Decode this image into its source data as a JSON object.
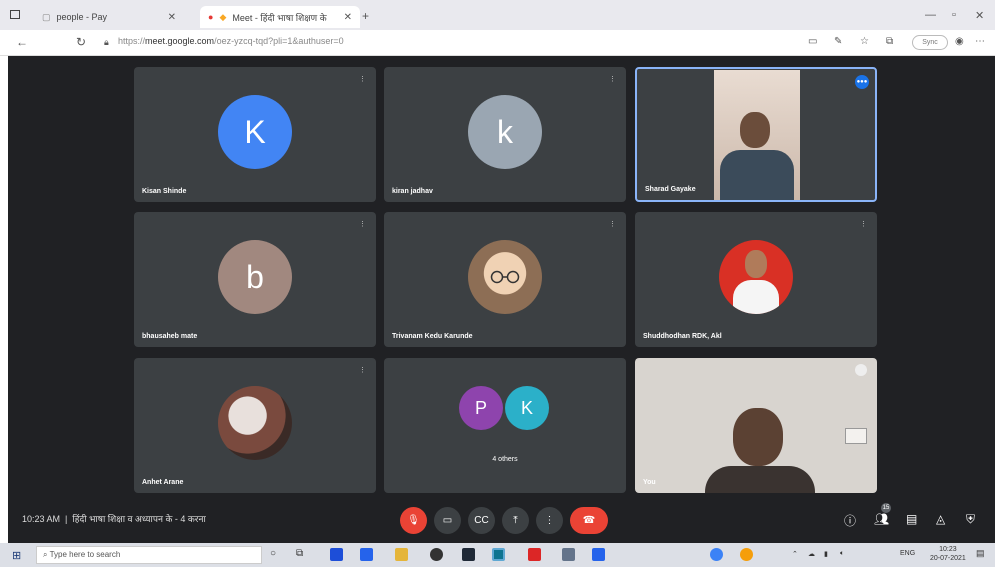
{
  "browser": {
    "tab1_label": "people - Pay",
    "tab2_label": "Meet - हिंदी भाषा शिक्षण के",
    "url_host": "meet.google.com",
    "url_rest": "/oez-yzcq-tqd?pli=1&authuser=0",
    "url_prefix": "https://",
    "sync_label": "Sync"
  },
  "tiles": [
    {
      "name": "Kisan Shinde",
      "initial": "K",
      "color": "#4285f4"
    },
    {
      "name": "kiran jadhav",
      "initial": "k",
      "color": "#9aa6b2"
    },
    {
      "name": "Sharad Gayake",
      "initial": "",
      "color": ""
    },
    {
      "name": "bhausaheb mate",
      "initial": "b",
      "color": "#a1887f"
    },
    {
      "name": "Trivanam Kedu Karunde",
      "initial": "",
      "color": ""
    },
    {
      "name": "Shuddhodhan RDK, Akl",
      "initial": "",
      "color": ""
    },
    {
      "name": "Anhet Arane",
      "initial": "",
      "color": ""
    },
    {
      "name": "4 others",
      "initial": "",
      "color": ""
    },
    {
      "name": "You",
      "initial": "",
      "color": ""
    }
  ],
  "others_avatars": [
    {
      "initial": "P",
      "color": "#8e44ad"
    },
    {
      "initial": "K",
      "color": "#2bb0c9"
    }
  ],
  "meeting": {
    "time": "10:23 AM",
    "title": "हिंदी भाषा शिक्षा व अध्यापन के - 4 करना",
    "participant_count": "15"
  },
  "taskbar": {
    "search_placeholder": "Type here to search",
    "tray_time": "10:23",
    "tray_date": "20-07-2021",
    "tray_lang": "ENG"
  },
  "colors": {
    "meet_bg": "#202124",
    "tile_bg": "#3c4043",
    "end_call": "#ea4335",
    "active_border": "#8ab4f8"
  }
}
